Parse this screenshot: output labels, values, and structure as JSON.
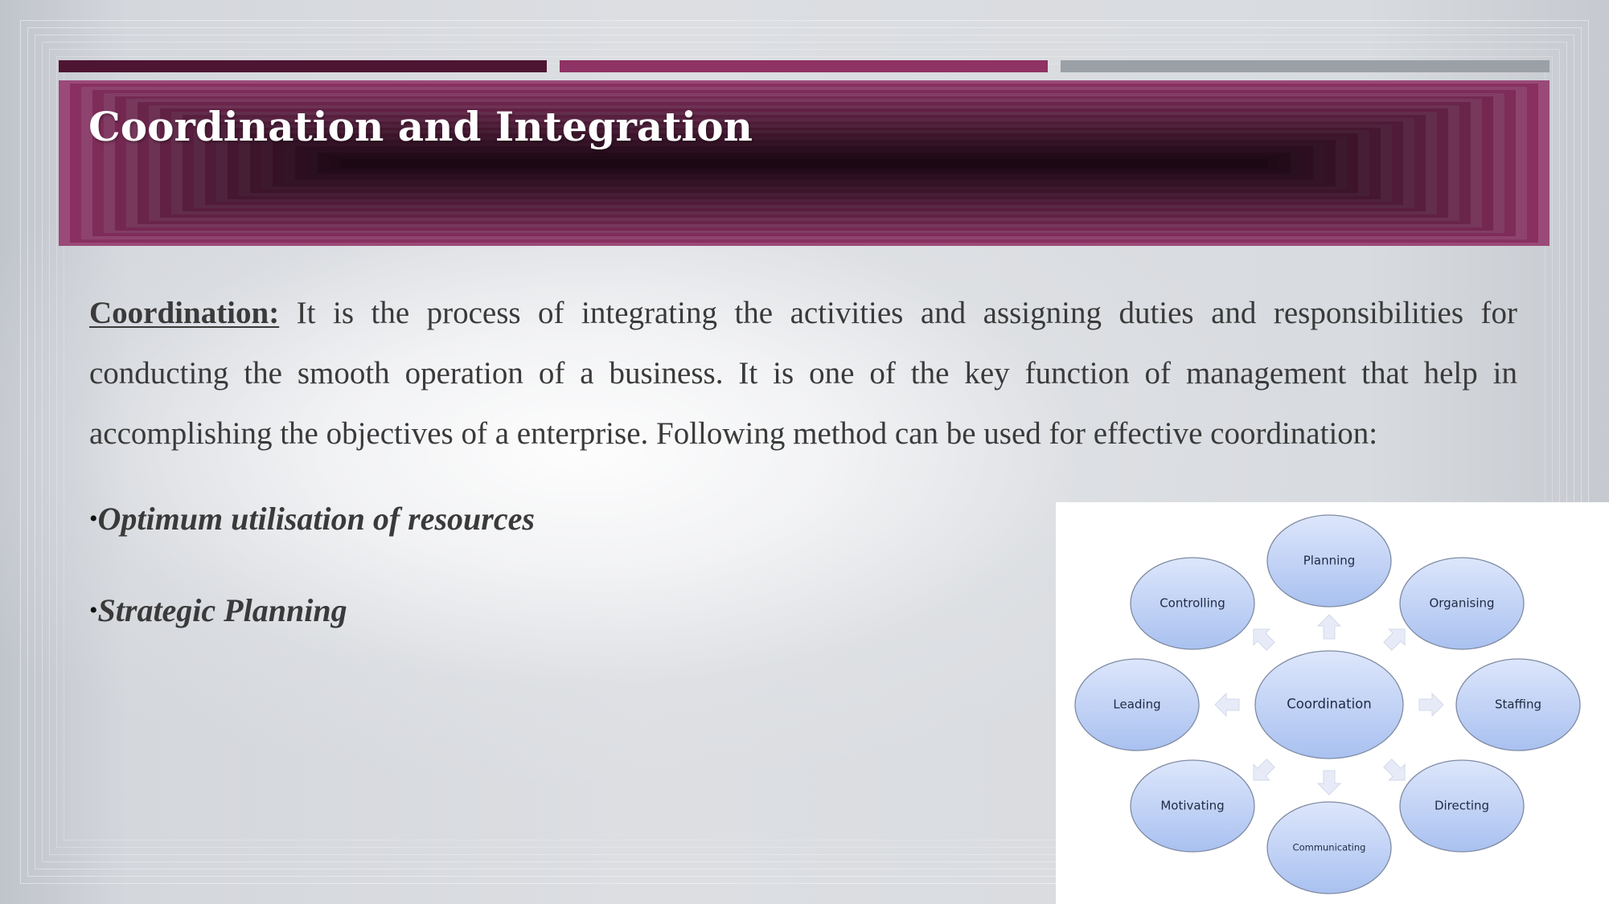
{
  "slide": {
    "title": "Coordination and Integration",
    "accent_colors": [
      "#4e1533",
      "#8f3264",
      "#9aa0a6"
    ],
    "title_band_color": "#8f3264",
    "body": {
      "term": "Coordination:",
      "text": " It is the process of integrating the activities and assigning duties and responsibilities for conducting the smooth operation of a business. It is one of the key function of management that help in accomplishing the objectives of a enterprise. Following method can be used for effective coordination:"
    },
    "bullets": [
      {
        "marker": "•",
        "label": "Optimum utilisation of resources"
      },
      {
        "marker": "•",
        "label": "Strategic Planning"
      }
    ]
  },
  "diagram": {
    "center": {
      "label": "Coordination"
    },
    "nodes": [
      {
        "id": "planning",
        "label": "Planning",
        "direction": "up"
      },
      {
        "id": "organising",
        "label": "Organising",
        "direction": "up-right"
      },
      {
        "id": "staffing",
        "label": "Staffing",
        "direction": "right"
      },
      {
        "id": "directing",
        "label": "Directing",
        "direction": "down-right"
      },
      {
        "id": "communicating",
        "label": "Communicating",
        "direction": "down"
      },
      {
        "id": "motivating",
        "label": "Motivating",
        "direction": "down-left"
      },
      {
        "id": "leading",
        "label": "Leading",
        "direction": "left"
      },
      {
        "id": "controlling",
        "label": "Controlling",
        "direction": "up-left"
      }
    ],
    "node_fill_top": "#dde6fb",
    "node_fill_bottom": "#a9c1f0",
    "node_stroke": "#7f8ba3",
    "arrow_fill": "#e6ebf7"
  }
}
